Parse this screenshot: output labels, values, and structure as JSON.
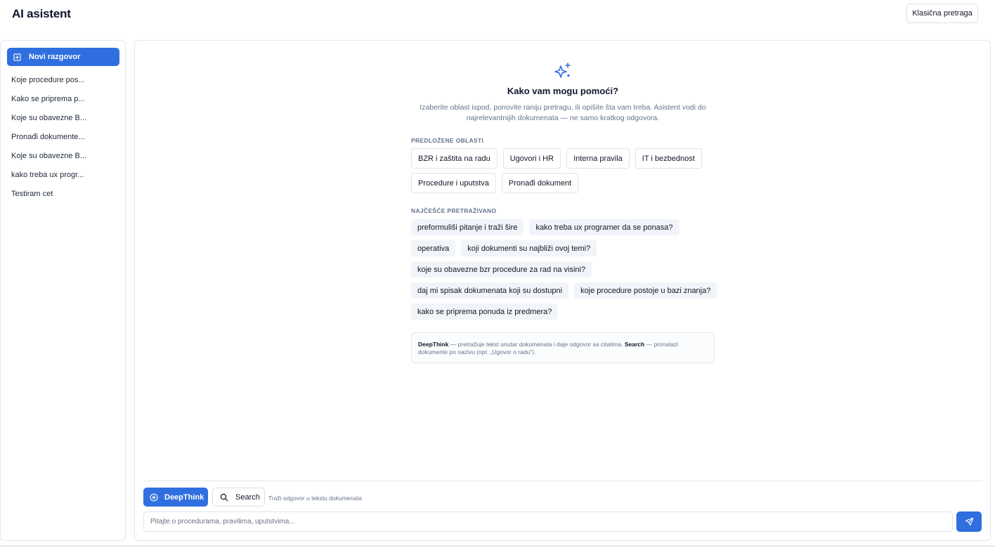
{
  "app": {
    "title": "AI asistent",
    "classic_search": "Klasična pretraga"
  },
  "sidebar": {
    "new_chat": "Novi razgovor",
    "history": [
      "Koje procedure pos...",
      "Kako se priprema p...",
      "Koje su obavezne B...",
      "Pronađi dokumente...",
      "Koje su obavezne B...",
      "kako treba ux progr...",
      "Testiram cet"
    ]
  },
  "hero": {
    "title": "Kako vam mogu pomoći?",
    "subtitle": "Izaberite oblast ispod, ponovite raniju pretragu, ili opišite šta vam treba. Asistent vodi do najrelevantnijih dokumenata — ne samo kratkog odgovora."
  },
  "suggested": {
    "label": "PREDLOŽENE OBLASTI",
    "areas": [
      "BZR i zaštita na radu",
      "Ugovori i HR",
      "Interna pravila",
      "IT i bezbednost",
      "Procedure i uputstva",
      "Pronađi dokument"
    ]
  },
  "popular": {
    "label": "NAJČEŠĆE PRETRAŽIVANO",
    "queries": [
      "preformuliši pitanje i traži šire",
      "kako treba ux programer da se ponasa?",
      "operativa",
      "koji dokumenti su najbliži ovoj temi?",
      "koje su obavezne bzr procedure za rad na visini?",
      "daj mi spisak dokumenata koji su dostupni",
      "koje procedure postoje u bazi znanja?",
      "kako se priprema ponuda iz predmera?"
    ]
  },
  "info": {
    "deepthink_label": "DeepThink",
    "deepthink_text": " — pretražuje tekst unutar dokumenata i daje odgovor sa citatima. ",
    "search_label": "Search",
    "search_text": " — pronalazi dokumente po nazivu (npr. „Ugovor o radu\")."
  },
  "composer": {
    "deepthink": "DeepThink",
    "search": "Search",
    "hint": "Traži odgovor u tekstu dokumenata",
    "placeholder": "Pitajte o procedurama, pravilima, uputstvima..."
  },
  "colors": {
    "accent": "#2f6fe0",
    "chip_bg": "#f1f4f8",
    "muted_text": "#64748b"
  }
}
